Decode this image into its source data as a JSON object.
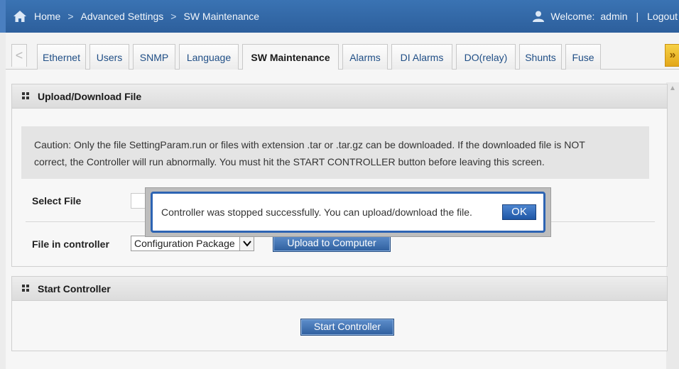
{
  "header": {
    "breadcrumb": [
      "Home",
      "Advanced Settings",
      "SW Maintenance"
    ],
    "welcome_label": "Welcome:",
    "username": "admin",
    "separator": "|",
    "logout": "Logout"
  },
  "tabs": [
    {
      "label": "Ethernet",
      "active": false
    },
    {
      "label": "Users",
      "active": false
    },
    {
      "label": "SNMP",
      "active": false
    },
    {
      "label": "Language",
      "active": false
    },
    {
      "label": "SW Maintenance",
      "active": true
    },
    {
      "label": "Alarms",
      "active": false
    },
    {
      "label": "DI Alarms",
      "active": false
    },
    {
      "label": "DO(relay)",
      "active": false
    },
    {
      "label": "Shunts",
      "active": false
    },
    {
      "label": "Fuse",
      "active": false
    }
  ],
  "tab_nav": {
    "prev": "<",
    "next": "»"
  },
  "upload_panel": {
    "title": "Upload/Download File",
    "caution_line1": "Caution: Only the file SettingParam.run or files with extension .tar or .tar.gz can be downloaded. If the downloaded file is NOT",
    "caution_line2": "correct, the Controller will run abnormally. You must hit the START CONTROLLER button before leaving this screen.",
    "select_file_label": "Select File",
    "file_in_controller_label": "File in controller",
    "selected_option": "Configuration Package",
    "upload_button": "Upload to Computer"
  },
  "start_panel": {
    "title": "Start Controller",
    "button": "Start Controller"
  },
  "dialog": {
    "message": "Controller was stopped successfully. You can upload/download the file.",
    "ok": "OK"
  },
  "colors": {
    "header_blue": "#2d5f9c",
    "button_blue": "#2f5f9e",
    "dialog_border": "#2d64b3",
    "next_arrow_gold": "#e3a71a"
  }
}
